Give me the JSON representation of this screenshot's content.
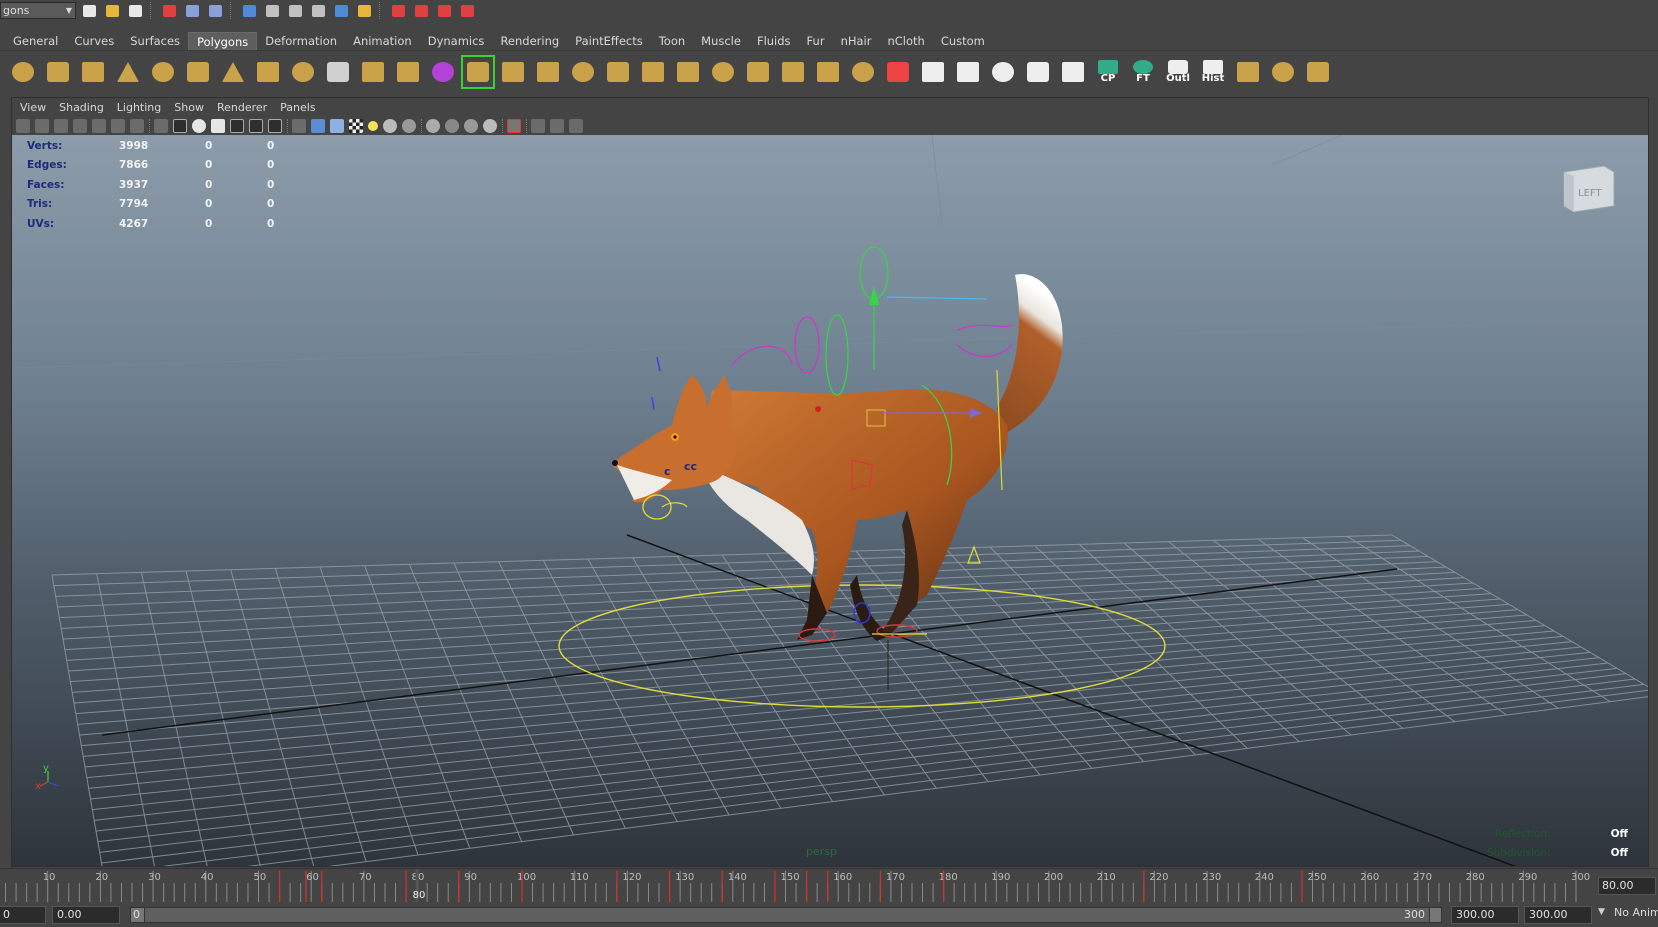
{
  "toolbar": {
    "mode_value": "gons",
    "icons": [
      "new-scene-icon",
      "open-scene-icon",
      "save-scene-icon",
      "select-hierarchy-icon",
      "select-object-icon",
      "select-component-icon",
      "snap-grid-icon",
      "snap-curve-icon",
      "snap-point-icon",
      "snap-plane-icon",
      "snap-live-icon",
      "construction-history-icon",
      "render-icon",
      "ipr-render-icon",
      "render-settings-icon",
      "hypershade-icon"
    ]
  },
  "shelf": {
    "active_tab": "Polygons",
    "tabs": [
      "General",
      "Curves",
      "Surfaces",
      "Polygons",
      "Deformation",
      "Animation",
      "Dynamics",
      "Rendering",
      "PaintEffects",
      "Toon",
      "Muscle",
      "Fluids",
      "Fur",
      "nHair",
      "nCloth",
      "Custom"
    ],
    "icons": [
      {
        "name": "poly-sphere-icon",
        "color": "#c9a24a"
      },
      {
        "name": "poly-cube-icon",
        "color": "#c9a24a"
      },
      {
        "name": "poly-cylinder-icon",
        "color": "#c9a24a"
      },
      {
        "name": "poly-cone-icon",
        "color": "#c9a24a"
      },
      {
        "name": "poly-plane-icon",
        "color": "#c9a24a"
      },
      {
        "name": "poly-torus-icon",
        "color": "#c9a24a"
      },
      {
        "name": "poly-pyramid-icon",
        "color": "#c9a24a"
      },
      {
        "name": "poly-pipe-icon",
        "color": "#c9a24a"
      },
      {
        "name": "poly-soccer-ball-icon",
        "color": "#c9a24a"
      },
      {
        "name": "combine-icon",
        "color": "#d0d0d0"
      },
      {
        "name": "separate-icon",
        "color": "#c9a24a"
      },
      {
        "name": "extract-icon",
        "color": "#c9a24a"
      },
      {
        "name": "smooth-icon",
        "color": "#b342d9"
      },
      {
        "name": "sculpt-icon",
        "color": "#c9a24a",
        "selected": true
      },
      {
        "name": "extrude-icon",
        "color": "#c9a24a"
      },
      {
        "name": "bridge-icon",
        "color": "#c9a24a"
      },
      {
        "name": "append-polygon-icon",
        "color": "#c9a24a"
      },
      {
        "name": "split-polygon-icon",
        "color": "#c9a24a"
      },
      {
        "name": "insert-edge-loop-icon",
        "color": "#c9a24a"
      },
      {
        "name": "offset-edge-loop-icon",
        "color": "#c9a24a"
      },
      {
        "name": "bevel-icon",
        "color": "#c9a24a"
      },
      {
        "name": "poke-face-icon",
        "color": "#c9a24a"
      },
      {
        "name": "wedge-face-icon",
        "color": "#c9a24a"
      },
      {
        "name": "duplicate-face-icon",
        "color": "#c9a24a"
      },
      {
        "name": "merge-icon",
        "color": "#c9a24a"
      },
      {
        "name": "cone-merge-icon",
        "color": "#e44"
      },
      {
        "name": "uv-planar-icon",
        "color": "#eee"
      },
      {
        "name": "uv-cylindrical-icon",
        "color": "#eee"
      },
      {
        "name": "uv-spherical-icon",
        "color": "#eee"
      },
      {
        "name": "uv-automatic-icon",
        "color": "#eee"
      },
      {
        "name": "uv-editor-icon",
        "color": "#eee"
      },
      {
        "name": "center-pivot-icon",
        "color": "#3a8",
        "label": "CP"
      },
      {
        "name": "freeze-transform-icon",
        "color": "#3a8",
        "label": "FT"
      },
      {
        "name": "outliner-icon",
        "color": "#eee",
        "label": "Outl"
      },
      {
        "name": "history-icon",
        "color": "#eee",
        "label": "Hist"
      },
      {
        "name": "layer-icon",
        "color": "#c9a24a"
      },
      {
        "name": "layer-editor-icon",
        "color": "#c9a24a"
      },
      {
        "name": "graph-icon",
        "color": "#c9a24a"
      }
    ]
  },
  "panel": {
    "menus": [
      "View",
      "Shading",
      "Lighting",
      "Show",
      "Renderer",
      "Panels"
    ],
    "hud": [
      {
        "label": "Verts:",
        "v1": "3998",
        "v2": "0",
        "v3": "0"
      },
      {
        "label": "Edges:",
        "v1": "7866",
        "v2": "0",
        "v3": "0"
      },
      {
        "label": "Faces:",
        "v1": "3937",
        "v2": "0",
        "v3": "0"
      },
      {
        "label": "Tris:",
        "v1": "7794",
        "v2": "0",
        "v3": "0"
      },
      {
        "label": "UVs:",
        "v1": "4267",
        "v2": "0",
        "v3": "0"
      }
    ],
    "view_cube_label": "LEFT",
    "camera_name": "persp",
    "hud_right": [
      {
        "label": "Reflection:",
        "value": "Off"
      },
      {
        "label": "Subdivision:",
        "value": "Off"
      }
    ],
    "axis": {
      "y": "y",
      "x": "x"
    }
  },
  "timeline": {
    "ticks": [
      10,
      20,
      30,
      40,
      50,
      60,
      70,
      80,
      90,
      100,
      110,
      120,
      130,
      140,
      150,
      160,
      170,
      180,
      190,
      200,
      210,
      220,
      230,
      240,
      250,
      260,
      270,
      280,
      290,
      300
    ],
    "current_frame": "80",
    "current_time": "80.00",
    "keyframes": [
      54,
      59,
      62,
      78,
      88,
      100,
      118,
      128,
      138,
      148,
      154,
      158,
      168,
      180,
      218,
      248
    ]
  },
  "range": {
    "start_field": "0",
    "start_min": "0.00",
    "range_start": "0",
    "range_end": "300",
    "end_field": "300.00",
    "max_field": "300.00",
    "anim_layer": "No Anim"
  }
}
